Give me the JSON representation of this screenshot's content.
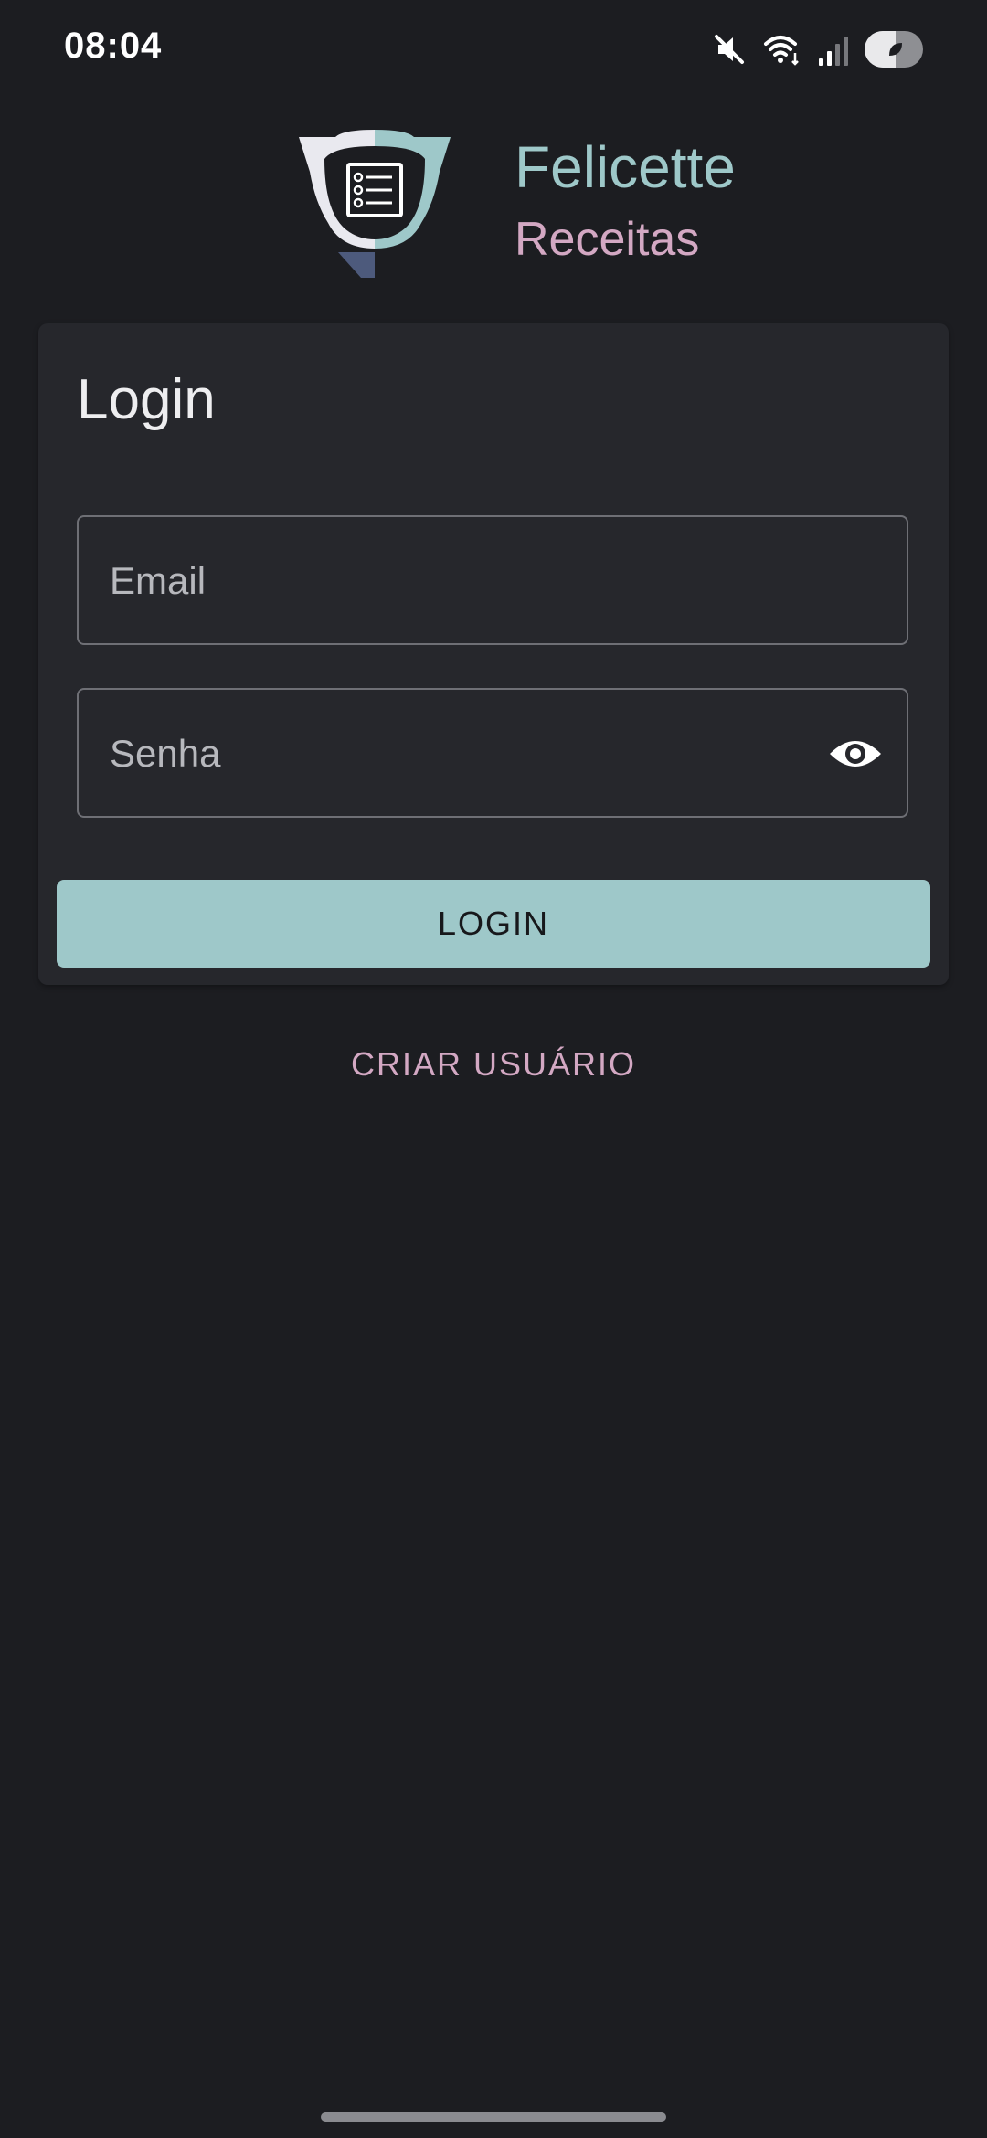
{
  "status_bar": {
    "time": "08:04",
    "icons": [
      "mute-icon",
      "wifi-icon",
      "signal-icon",
      "battery-saver-icon"
    ]
  },
  "brand": {
    "title": "Felicette",
    "subtitle": "Receitas",
    "logo_icon": "recipe-list-logo"
  },
  "login_card": {
    "title": "Login",
    "email_placeholder": "Email",
    "password_placeholder": "Senha",
    "toggle_visibility_icon": "eye-icon",
    "login_button_label": "LOGIN"
  },
  "create_user_label": "CRIAR USUÁRIO",
  "colors": {
    "background": "#1c1d21",
    "card": "#26272c",
    "accent_teal": "#9ec8c9",
    "accent_pink": "#d3a8c3"
  }
}
